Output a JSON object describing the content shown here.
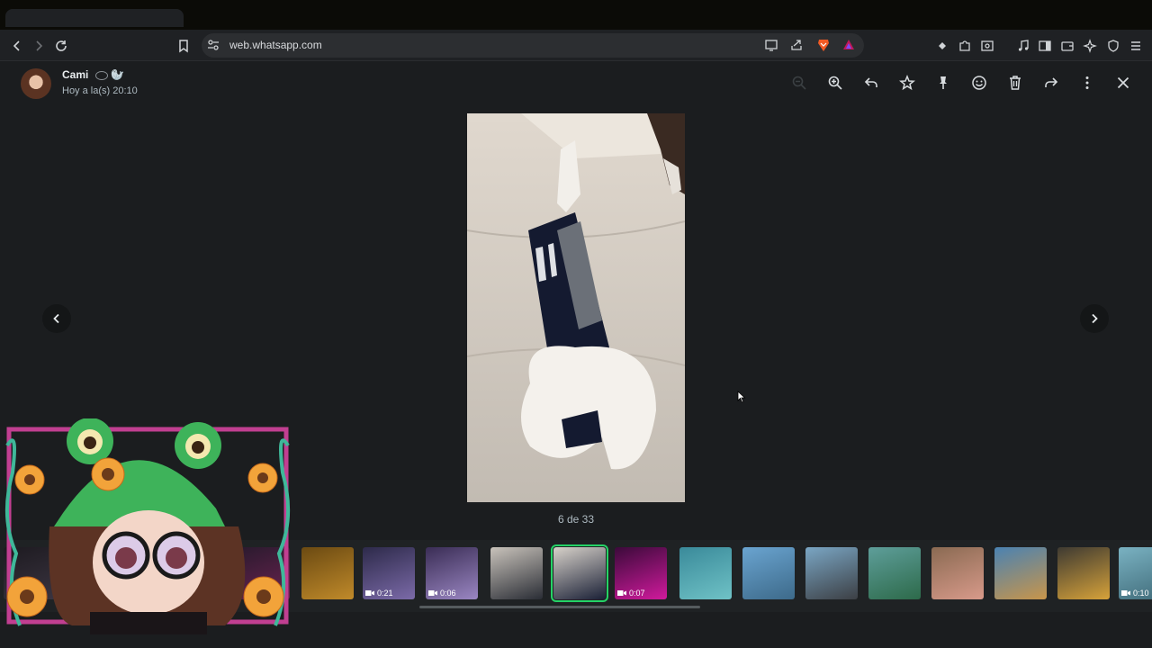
{
  "browser": {
    "url": "web.whatsapp.com",
    "toolbar_icons": [
      "back-icon",
      "forward-icon",
      "reload-icon",
      "bookmark-icon",
      "site-info-icon",
      "cast-icon",
      "share-icon",
      "brave-shields-icon",
      "brave-rewards-icon",
      "extension-icon",
      "puzzle-icon",
      "screenshot-icon",
      "media-icon",
      "sidebar-icon",
      "wallet-icon",
      "leo-ai-icon",
      "vpn-icon",
      "menu-icon"
    ]
  },
  "header": {
    "contact_name": "Cami",
    "contact_emoji": "🦭",
    "timestamp": "Hoy a la(s) 20:10",
    "actions": [
      "zoom-out-icon",
      "zoom-in-icon",
      "reply-icon",
      "star-icon",
      "pin-icon",
      "emoji-icon",
      "delete-icon",
      "forward-icon",
      "more-options-icon",
      "close-icon"
    ]
  },
  "viewer": {
    "counter": "6 de 33"
  },
  "thumbnails": [
    {
      "type": "image",
      "palette": [
        "#1d1a20",
        "#3a3440"
      ]
    },
    {
      "type": "image",
      "palette": [
        "#2a1a2e",
        "#6b2350"
      ]
    },
    {
      "type": "image",
      "palette": [
        "#6b4a12",
        "#c08a2a"
      ]
    },
    {
      "type": "video",
      "duration": "0:21",
      "palette": [
        "#2d2a4a",
        "#7b6aa8"
      ]
    },
    {
      "type": "video",
      "duration": "0:06",
      "palette": [
        "#3a2d55",
        "#9a86c2"
      ]
    },
    {
      "type": "image",
      "palette": [
        "#c9c3bb",
        "#2a2d35"
      ]
    },
    {
      "type": "image",
      "active": true,
      "palette": [
        "#d8d2ca",
        "#1a2036"
      ]
    },
    {
      "type": "video",
      "duration": "0:07",
      "palette": [
        "#3b0a3a",
        "#d01a9c"
      ]
    },
    {
      "type": "image",
      "palette": [
        "#3a8a9a",
        "#6fc2c6"
      ]
    },
    {
      "type": "image",
      "palette": [
        "#6aa4d0",
        "#3d6a8a"
      ]
    },
    {
      "type": "image",
      "palette": [
        "#7aa6c4",
        "#3c3f44"
      ]
    },
    {
      "type": "image",
      "palette": [
        "#5e9e9a",
        "#2d6a4a"
      ]
    },
    {
      "type": "image",
      "palette": [
        "#8a6a52",
        "#d89a8a"
      ]
    },
    {
      "type": "image",
      "palette": [
        "#4a82b2",
        "#c8954a"
      ]
    },
    {
      "type": "image",
      "palette": [
        "#3e3a32",
        "#d6a23a"
      ]
    },
    {
      "type": "video",
      "duration": "0:10",
      "palette": [
        "#7ab2c2",
        "#3f6a78"
      ]
    }
  ],
  "colors": {
    "accent": "#25d366",
    "header_bg": "#1b1d1f",
    "strip_bg": "#1f2224"
  }
}
